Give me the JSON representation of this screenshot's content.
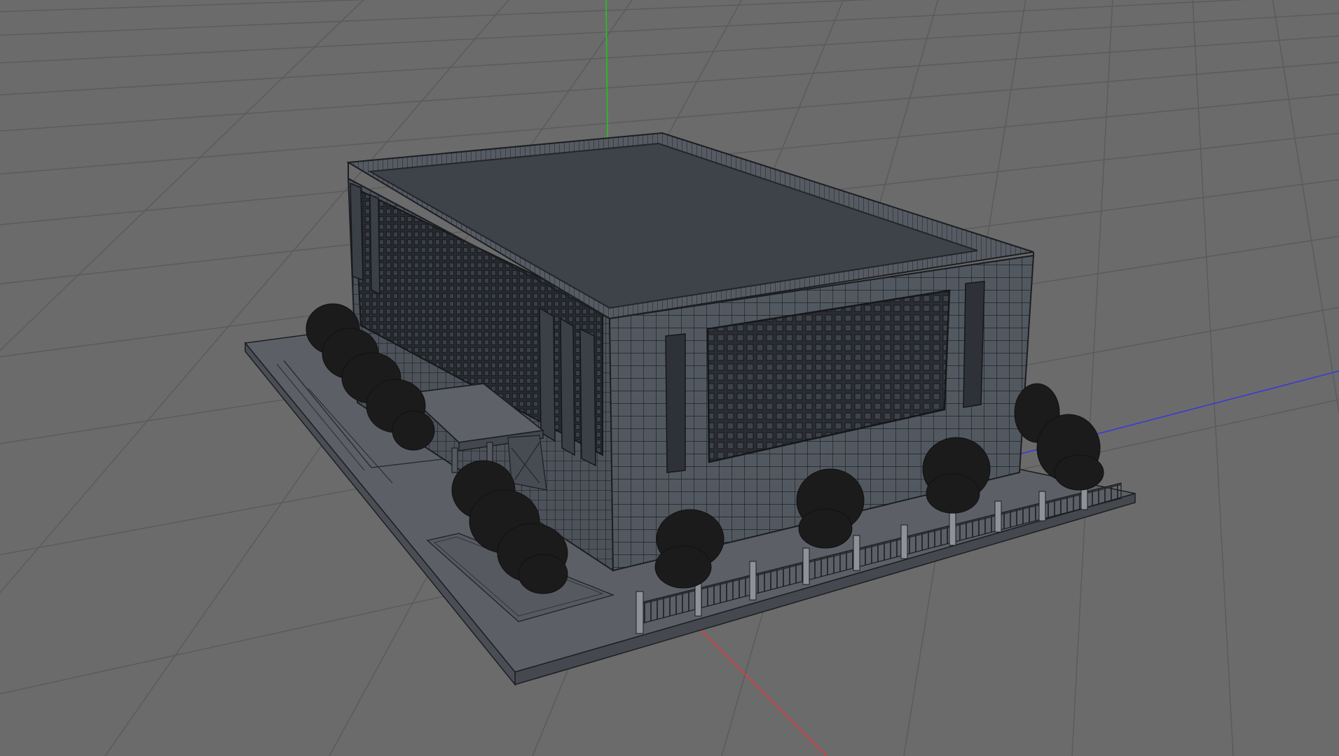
{
  "viewport": {
    "view": "perspective",
    "display_mode": "gouraud-shading-lines"
  },
  "colors": {
    "background": "#6b6b6b",
    "grid": "#5a5a5a",
    "axis_x": "#e23a3a",
    "axis_y": "#22c41e",
    "axis_z": "#3a3ad8",
    "model_fill": "#50555d",
    "model_roof": "#3e4249",
    "model_wire": "#1c1e22",
    "foliage": "#1b1b1b",
    "ground_plate": "#5a5e64"
  },
  "icons": {
    "world-origin": "axis-gizmo"
  }
}
